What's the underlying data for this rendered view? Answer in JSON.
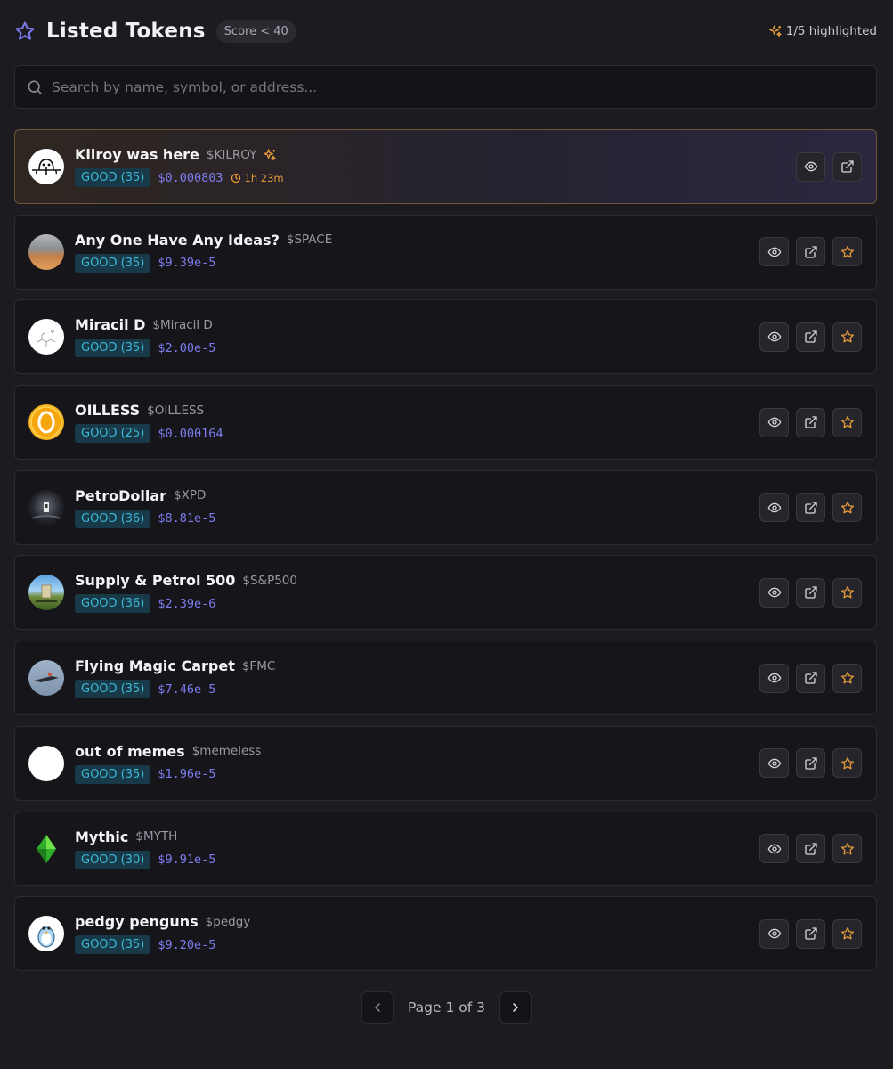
{
  "header": {
    "title": "Listed Tokens",
    "score_filter": "Score < 40",
    "highlighted": "1/5 highlighted"
  },
  "search": {
    "placeholder": "Search by name, symbol, or address...",
    "value": ""
  },
  "colors": {
    "accent": "#7d7df0",
    "good_badge_text": "#3bb8d6",
    "good_badge_bg": "#183a48",
    "star": "#e59a3a",
    "background": "#1c1b20"
  },
  "tokens": [
    {
      "name": "Kilroy was here",
      "symbol": "$KILROY",
      "badge": "GOOD (35)",
      "price": "$0.000803",
      "timer": "1h 23m",
      "featured": true,
      "avatar": "kilroy-avatar"
    },
    {
      "name": "Any One Have Any Ideas?",
      "symbol": "$SPACE",
      "badge": "GOOD (35)",
      "price": "$9.39e-5",
      "avatar": "space-avatar"
    },
    {
      "name": "Miracil D",
      "symbol": "$Miracil D",
      "badge": "GOOD (35)",
      "price": "$2.00e-5",
      "avatar": "miracil-avatar"
    },
    {
      "name": "OILLESS",
      "symbol": "$OILLESS",
      "badge": "GOOD (25)",
      "price": "$0.000164",
      "avatar": "oilless-avatar"
    },
    {
      "name": "PetroDollar",
      "symbol": "$XPD",
      "badge": "GOOD (36)",
      "price": "$8.81e-5",
      "avatar": "petrodollar-avatar"
    },
    {
      "name": "Supply & Petrol 500",
      "symbol": "$S&P500",
      "badge": "GOOD (36)",
      "price": "$2.39e-6",
      "avatar": "sp500-avatar"
    },
    {
      "name": "Flying Magic Carpet",
      "symbol": "$FMC",
      "badge": "GOOD (35)",
      "price": "$7.46e-5",
      "avatar": "fmc-avatar"
    },
    {
      "name": "out of memes",
      "symbol": "$memeless",
      "badge": "GOOD (35)",
      "price": "$1.96e-5",
      "avatar": "memeless-avatar"
    },
    {
      "name": "Mythic",
      "symbol": "$MYTH",
      "badge": "GOOD (30)",
      "price": "$9.91e-5",
      "avatar": "myth-avatar"
    },
    {
      "name": "pedgy penguns",
      "symbol": "$pedgy",
      "badge": "GOOD (35)",
      "price": "$9.20e-5",
      "avatar": "pedgy-avatar"
    }
  ],
  "pagination": {
    "label": "Page 1 of 3"
  }
}
